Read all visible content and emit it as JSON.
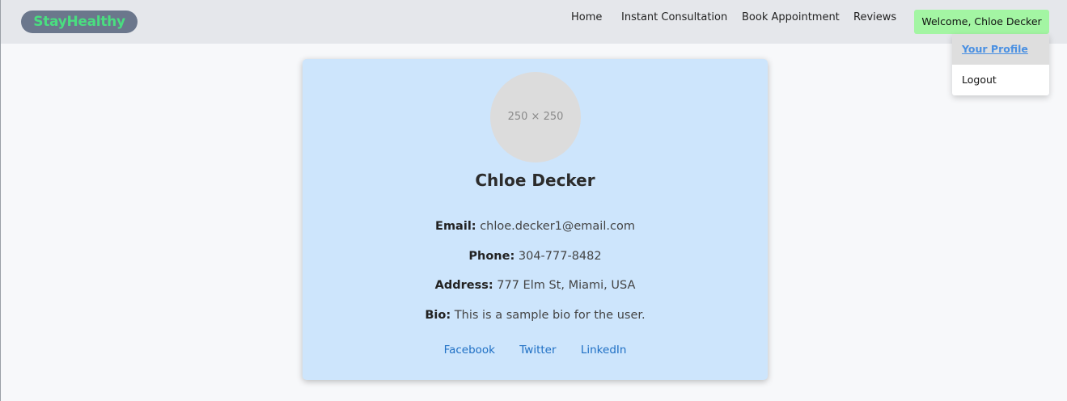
{
  "nav": {
    "logo": "StayHealthy",
    "links": [
      "Home",
      "Instant Consultation",
      "Book Appointment",
      "Reviews"
    ],
    "welcome": "Welcome, Chloe Decker",
    "dropdown": {
      "profile": "Your Profile",
      "logout": "Logout"
    }
  },
  "profile": {
    "avatar_placeholder": "250 × 250",
    "name": "Chloe Decker",
    "email_label": "Email:",
    "email": "chloe.decker1@email.com",
    "phone_label": "Phone:",
    "phone": "304-777-8482",
    "address_label": "Address:",
    "address": "777 Elm St, Miami, USA",
    "bio_label": "Bio:",
    "bio": "This is a sample bio for the user.",
    "socials": [
      "Facebook",
      "Twitter",
      "LinkedIn"
    ]
  },
  "colors": {
    "navbar_bg": "#e5e7eb",
    "logo_bg": "#6b778c",
    "logo_text": "#4ade80",
    "welcome_bg": "#a3f5a3",
    "card_bg": "#cde5fc",
    "link": "#1e6fc4",
    "profile_link": "#4a90e2"
  }
}
